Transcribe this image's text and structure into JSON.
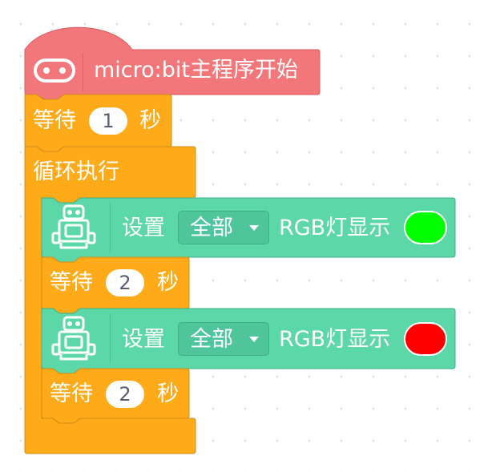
{
  "hat": {
    "label": "micro:bit主程序开始",
    "icon": "microbit-icon",
    "color": "#f2777a"
  },
  "blocks": {
    "wait1": {
      "label": "等待",
      "value": "1",
      "unit": "秒"
    },
    "loop": {
      "label": "循环执行"
    },
    "set1": {
      "label": "设置",
      "target": "全部",
      "suffix": "RGB灯显示",
      "color": "#00ff00",
      "icon": "robot-icon"
    },
    "wait2": {
      "label": "等待",
      "value": "2",
      "unit": "秒"
    },
    "set2": {
      "label": "设置",
      "target": "全部",
      "suffix": "RGB灯显示",
      "color": "#ff0000",
      "icon": "robot-icon"
    },
    "wait3": {
      "label": "等待",
      "value": "2",
      "unit": "秒"
    }
  },
  "colors": {
    "control": "#ffab19",
    "control_border": "#cf8b17",
    "extension": "#5cd8a8",
    "extension_border": "#3fae87",
    "event": "#f2777a"
  }
}
